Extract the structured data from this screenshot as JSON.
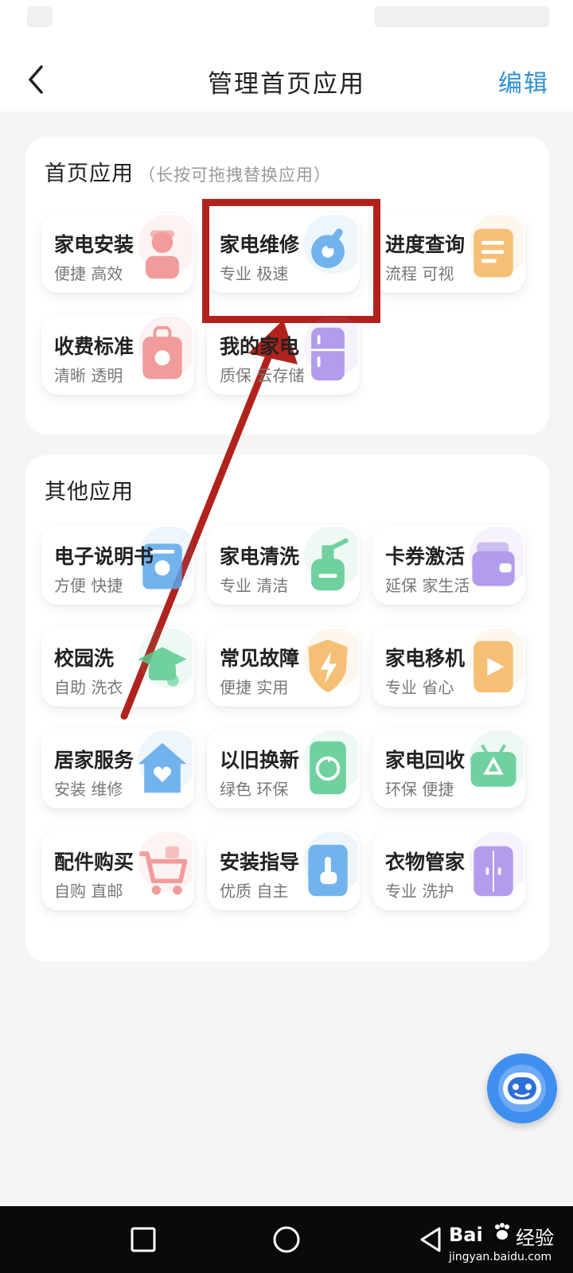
{
  "header": {
    "title": "管理首页应用",
    "edit_label": "编辑"
  },
  "home_section": {
    "title": "首页应用",
    "hint": "（长按可拖拽替换应用）",
    "apps": [
      {
        "title": "家电安装",
        "subtitle": "便捷 高效",
        "icon": "installer-worker-icon",
        "color": "#f08a8a"
      },
      {
        "title": "家电维修",
        "subtitle": "专业 极速",
        "icon": "wrench-gear-icon",
        "color": "#5aa6ea"
      },
      {
        "title": "进度查询",
        "subtitle": "流程 可视",
        "icon": "document-list-icon",
        "color": "#f5b45e"
      },
      {
        "title": "收费标准",
        "subtitle": "清晰 透明",
        "icon": "price-tag-icon",
        "color": "#f08a8a"
      },
      {
        "title": "我的家电",
        "subtitle": "质保 云存储",
        "icon": "refrigerator-icon",
        "color": "#a58be8"
      }
    ]
  },
  "other_section": {
    "title": "其他应用",
    "apps": [
      {
        "title": "电子说明书",
        "subtitle": "方便 快捷",
        "icon": "manual-book-icon",
        "color": "#5aa6ea"
      },
      {
        "title": "家电清洗",
        "subtitle": "专业 清洁",
        "icon": "spray-bottle-icon",
        "color": "#57c98f"
      },
      {
        "title": "卡券激活",
        "subtitle": "延保 家生活",
        "icon": "wallet-card-icon",
        "color": "#a58be8"
      },
      {
        "title": "校园洗",
        "subtitle": "自助 洗衣",
        "icon": "graduation-cap-icon",
        "color": "#57c98f"
      },
      {
        "title": "常见故障",
        "subtitle": "便捷 实用",
        "icon": "lightning-shield-icon",
        "color": "#f5b45e"
      },
      {
        "title": "家电移机",
        "subtitle": "专业 省心",
        "icon": "move-document-icon",
        "color": "#f5b45e"
      },
      {
        "title": "居家服务",
        "subtitle": "安装 维修",
        "icon": "house-heart-icon",
        "color": "#5aa6ea"
      },
      {
        "title": "以旧换新",
        "subtitle": "绿色 环保",
        "icon": "exchange-phone-icon",
        "color": "#57c98f"
      },
      {
        "title": "家电回收",
        "subtitle": "环保 便捷",
        "icon": "recycle-tv-icon",
        "color": "#57c98f"
      },
      {
        "title": "配件购买",
        "subtitle": "自购 直邮",
        "icon": "shopping-cart-icon",
        "color": "#f08a8a"
      },
      {
        "title": "安装指导",
        "subtitle": "优质 自主",
        "icon": "touch-guide-icon",
        "color": "#5aa6ea"
      },
      {
        "title": "衣物管家",
        "subtitle": "专业 洗护",
        "icon": "wardrobe-icon",
        "color": "#a58be8"
      }
    ]
  },
  "annotation": {
    "color": "#b2221c"
  },
  "assistant": {
    "icon": "robot-assistant-icon",
    "color": "#3f8ff0"
  },
  "navbar": {
    "recents_icon": "square-icon",
    "home_icon": "circle-icon",
    "back_icon": "triangle-back-icon"
  },
  "watermark": {
    "brand": "Bai",
    "brand_cn": "经验",
    "url": "jingyan.baidu.com"
  }
}
